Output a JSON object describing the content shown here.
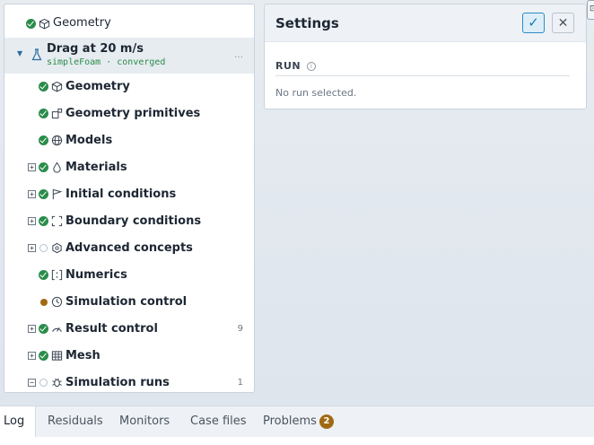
{
  "tree": {
    "top_item": {
      "label": "Geometry"
    },
    "study": {
      "title": "Drag at 20 m/s",
      "subtitle": "simpleFoam · converged",
      "more": "…"
    },
    "items": [
      {
        "label": "Geometry",
        "status": "ok",
        "icon": "cube-icon",
        "expandable": false,
        "count": ""
      },
      {
        "label": "Geometry primitives",
        "status": "ok",
        "icon": "shapes-icon",
        "expandable": false,
        "count": ""
      },
      {
        "label": "Models",
        "status": "ok",
        "icon": "globe-icon",
        "expandable": false,
        "count": ""
      },
      {
        "label": "Materials",
        "status": "ok",
        "icon": "droplet-icon",
        "expandable": true,
        "count": ""
      },
      {
        "label": "Initial conditions",
        "status": "ok",
        "icon": "flag-icon",
        "expandable": true,
        "count": ""
      },
      {
        "label": "Boundary conditions",
        "status": "ok",
        "icon": "boundary-icon",
        "expandable": true,
        "count": ""
      },
      {
        "label": "Advanced concepts",
        "status": "empty",
        "icon": "hexagon-icon",
        "expandable": true,
        "count": ""
      },
      {
        "label": "Numerics",
        "status": "ok",
        "icon": "numerics-icon",
        "expandable": false,
        "count": ""
      },
      {
        "label": "Simulation control",
        "status": "pending",
        "icon": "clock-icon",
        "expandable": false,
        "count": ""
      },
      {
        "label": "Result control",
        "status": "ok",
        "icon": "gauge-icon",
        "expandable": true,
        "count": "9"
      },
      {
        "label": "Mesh",
        "status": "ok",
        "icon": "grid-icon",
        "expandable": true,
        "count": ""
      },
      {
        "label": "Simulation runs",
        "status": "empty",
        "icon": "bug-icon",
        "expandable": true,
        "expanded": true,
        "count": "1"
      }
    ]
  },
  "settings": {
    "title": "Settings",
    "apply_label": "✓",
    "close_label": "✕",
    "section": "RUN",
    "empty_text": "No run selected."
  },
  "bottom_tabs": {
    "tabs": [
      "Log",
      "Residuals",
      "Monitors",
      "Case files",
      "Problems"
    ],
    "problems_count": "2",
    "log_preview": "        "
  },
  "colors": {
    "ok": "#2a8c4a",
    "pending": "#a06a12",
    "accent": "#2b8cc4"
  }
}
